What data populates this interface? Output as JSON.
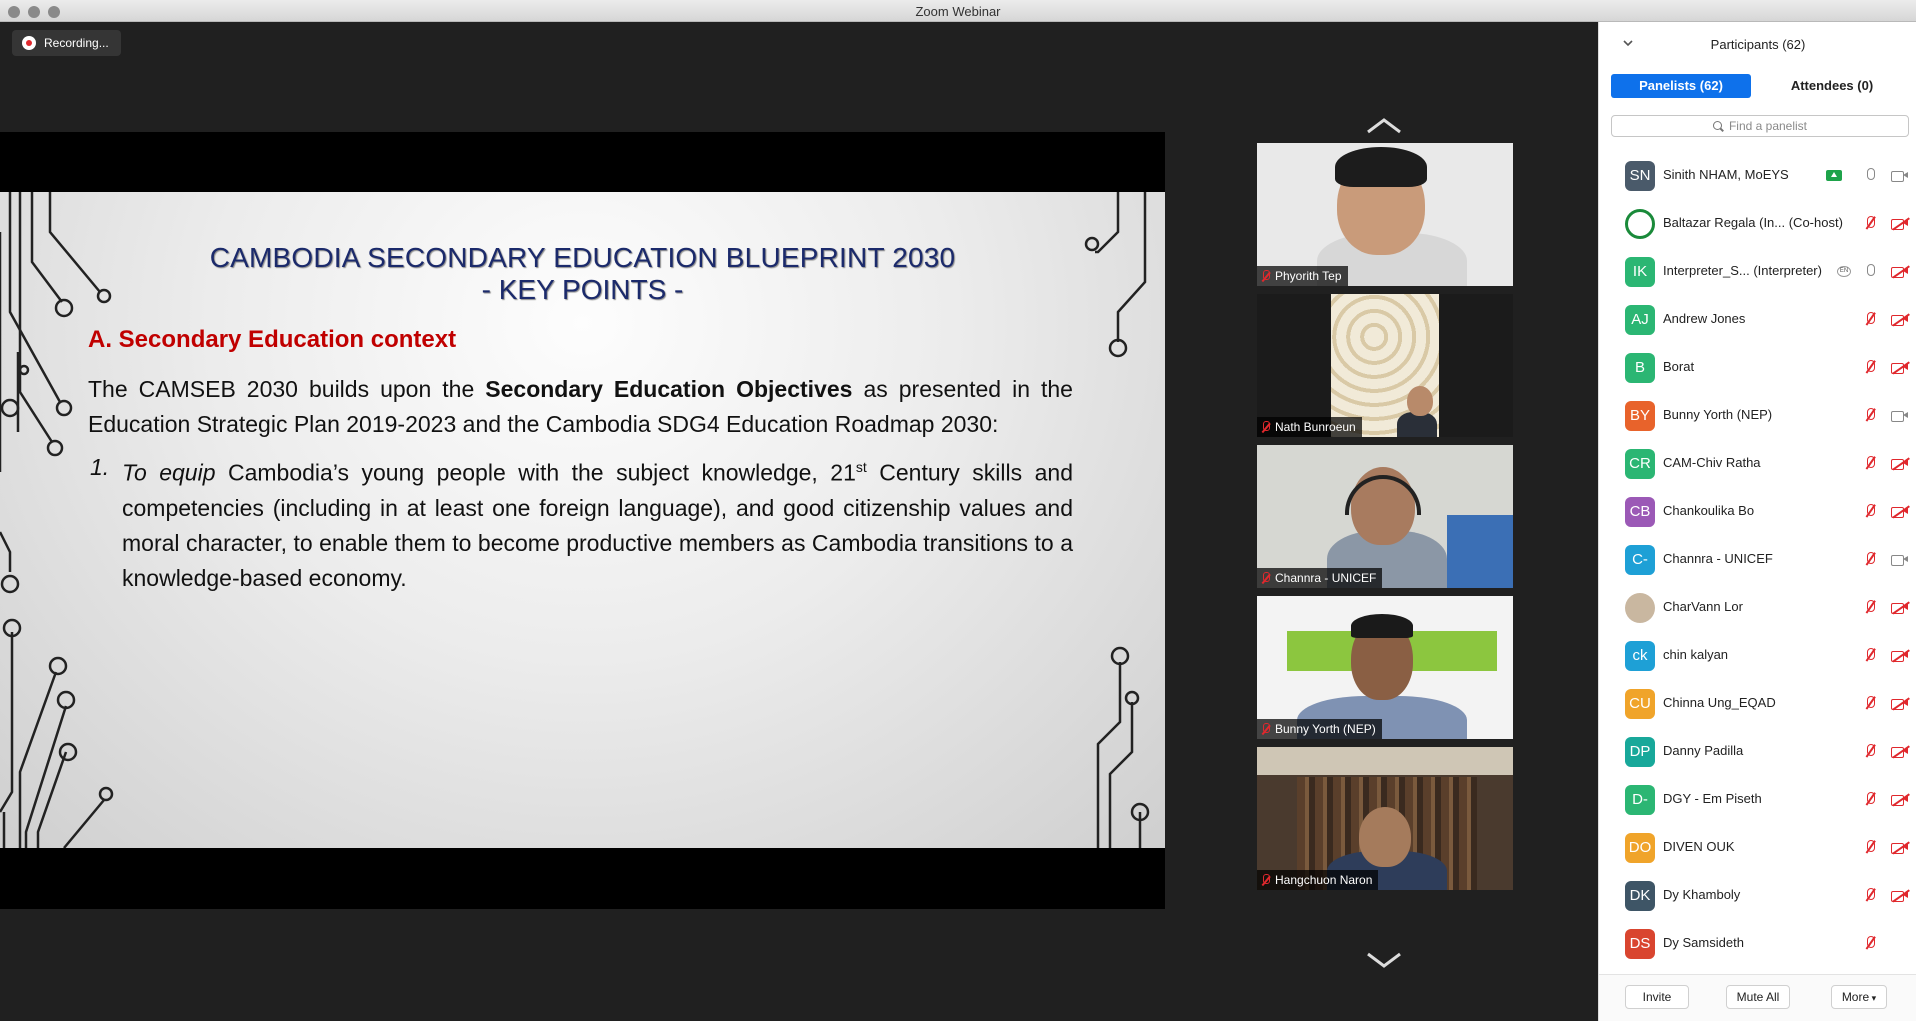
{
  "window": {
    "title": "Zoom Webinar"
  },
  "recording": {
    "label": "Recording..."
  },
  "slide": {
    "title_line1": "CAMBODIA SECONDARY EDUCATION BLUEPRINT 2030",
    "title_line2": "- KEY POINTS -",
    "section_heading": "A.  Secondary Education context",
    "para_prefix": "The CAMSEB 2030 builds upon the ",
    "para_bold": "Secondary Education Objectives",
    "para_suffix": " as presented in the Education Strategic Plan 2019-2023 and the Cambodia SDG4 Education Roadmap 2030:",
    "item_number": "1.",
    "item_lead": "To equip",
    "item_text_a": " Cambodia’s young people with the subject knowledge, 21",
    "item_sup": "st",
    "item_text_b": " Century skills and competencies (including in at least one foreign language), and good citizenship values and moral character, to enable them to become productive members as Cambodia transitions to a knowledge-based economy."
  },
  "video_tiles": [
    {
      "name": "Phyorith Tep",
      "muted": true
    },
    {
      "name": "Nath Bunroeun",
      "muted": true
    },
    {
      "name": "Channra - UNICEF",
      "muted": true
    },
    {
      "name": "Bunny Yorth (NEP)",
      "muted": true
    },
    {
      "name": "Hangchuon Naron",
      "muted": true
    }
  ],
  "participants_panel": {
    "title": "Participants (62)",
    "tab_panelists": "Panelists (62)",
    "tab_attendees": "Attendees (0)",
    "search_placeholder": "Find a panelist",
    "items": [
      {
        "initials": "SN",
        "name": "Sinith NHAM, MoEYS",
        "color": "#4a5a6a",
        "sharing": true,
        "mic": "on",
        "cam": "on"
      },
      {
        "initials": "",
        "name": "Baltazar Regala (In...  (Co-host)",
        "color": "#ffffff",
        "mic": "muted",
        "cam": "off",
        "image_avatar": "green-logo"
      },
      {
        "initials": "IK",
        "name": "Interpreter_S...  (Interpreter)",
        "color": "#2bb673",
        "lang": "EN",
        "mic": "on",
        "cam": "off"
      },
      {
        "initials": "AJ",
        "name": "Andrew Jones",
        "color": "#2bb673",
        "mic": "muted",
        "cam": "off"
      },
      {
        "initials": "B",
        "name": "Borat",
        "color": "#2bb673",
        "mic": "muted",
        "cam": "off"
      },
      {
        "initials": "BY",
        "name": "Bunny Yorth (NEP)",
        "color": "#e8632b",
        "mic": "muted",
        "cam": "on"
      },
      {
        "initials": "CR",
        "name": "CAM-Chiv Ratha",
        "color": "#2bb673",
        "mic": "muted",
        "cam": "off"
      },
      {
        "initials": "CB",
        "name": "Chankoulika Bo",
        "color": "#9b59b6",
        "mic": "muted",
        "cam": "off"
      },
      {
        "initials": "C-",
        "name": "Channra - UNICEF",
        "color": "#1ea0d6",
        "mic": "muted",
        "cam": "on"
      },
      {
        "initials": "",
        "name": "CharVann Lor",
        "color": "#c9b7a0",
        "mic": "muted",
        "cam": "off",
        "image_avatar": "photo"
      },
      {
        "initials": "ck",
        "name": "chin kalyan",
        "color": "#1ea0d6",
        "mic": "muted",
        "cam": "off"
      },
      {
        "initials": "CU",
        "name": "Chinna Ung_EQAD",
        "color": "#f0a42a",
        "mic": "muted",
        "cam": "off"
      },
      {
        "initials": "DP",
        "name": "Danny Padilla",
        "color": "#18a89a",
        "mic": "muted",
        "cam": "off"
      },
      {
        "initials": "D-",
        "name": "DGY - Em Piseth",
        "color": "#2bb673",
        "mic": "muted",
        "cam": "off"
      },
      {
        "initials": "DO",
        "name": "DIVEN OUK",
        "color": "#f0a42a",
        "mic": "muted",
        "cam": "off"
      },
      {
        "initials": "DK",
        "name": "Dy Khamboly",
        "color": "#3e5566",
        "mic": "muted",
        "cam": "off"
      },
      {
        "initials": "DS",
        "name": "Dy Samsideth",
        "color": "#d9452f",
        "mic": "muted",
        "cam": "none"
      }
    ],
    "buttons": {
      "invite": "Invite",
      "mute_all": "Mute All",
      "more": "More"
    }
  },
  "colors": {
    "accent": "#0e71eb",
    "muted_red": "#e0282d",
    "slide_title": "#1b2a6b",
    "slide_heading": "#c00000"
  }
}
